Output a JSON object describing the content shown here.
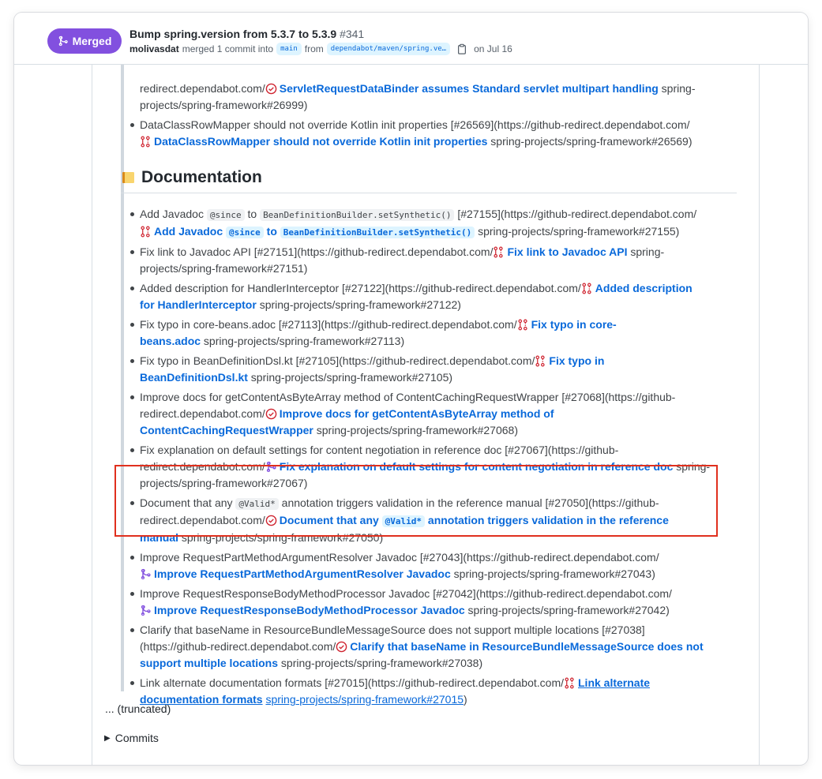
{
  "pr": {
    "status": "Merged",
    "title": "Bump spring.version from 5.3.7 to 5.3.9",
    "number": "#341",
    "author": "molivasdat",
    "merged_text": "merged 1 commit into",
    "base_branch": "main",
    "from_text": "from",
    "head_branch": "dependabot/maven/spring.ve…",
    "date": "on Jul 16",
    "badge_color": "#8250df"
  },
  "top_items": [
    {
      "pre": "redirect.dependabot.com/",
      "icon": "closed-check-icon",
      "link": "ServletRequestDataBinder assumes Standard servlet multipart handling",
      "post": " spring-",
      "line2": "projects/spring-framework#26999)"
    },
    {
      "pre": "DataClassRowMapper should not override Kotlin init properties [#26569](https://github-redirect.dependabot.com/",
      "icon": "issue-closed-icon",
      "link": "DataClassRowMapper should not override Kotlin init properties",
      "post": " spring-projects/spring-framework#26569)"
    }
  ],
  "heading": "Documentation",
  "doc_items": [
    {
      "a": "Add Javadoc ",
      "code1": "@since",
      "b": " to ",
      "code2": "BeanDefinitionBuilder.setSynthetic()",
      "c": " [#27155](https://github-redirect.dependabot.com/",
      "link_a": "Add Javadoc ",
      "link_code1": "@since",
      "link_b": " to ",
      "link_code2": "BeanDefinitionBuilder.setSynthetic()",
      "post": " spring-projects/spring-framework#27155)"
    },
    {
      "pre": "Fix link to Javadoc API [#27151](https://github-redirect.dependabot.com/",
      "link": "Fix link to Javadoc API",
      "post": " spring-",
      "line2": "projects/spring-framework#27151)"
    },
    {
      "pre": "Added description for HandlerInterceptor [#27122](https://github-redirect.dependabot.com/",
      "link": "Added description",
      "link2": "for HandlerInterceptor",
      "post": " spring-projects/spring-framework#27122)"
    },
    {
      "pre": "Fix typo in core-beans.adoc [#27113](https://github-redirect.dependabot.com/",
      "link": "Fix typo in core-",
      "link2": "beans.adoc",
      "post": " spring-projects/spring-framework#27113)"
    },
    {
      "pre": "Fix typo in BeanDefinitionDsl.kt [#27105](https://github-redirect.dependabot.com/",
      "link": "Fix typo in",
      "link2": "BeanDefinitionDsl.kt",
      "post": " spring-projects/spring-framework#27105)"
    },
    {
      "pre": "Improve docs for getContentAsByteArray method of ContentCachingRequestWrapper [#27068](https://github-",
      "pre2": "redirect.dependabot.com/",
      "link": "Improve docs for getContentAsByteArray method of",
      "link2": "ContentCachingRequestWrapper",
      "post": " spring-projects/spring-framework#27068)"
    },
    {
      "pre": "Fix explanation on default settings for content negotiation in reference doc [#27067](https://github-",
      "pre2": "redirect.dependabot.com/",
      "link": "Fix explanation on default settings for content negotiation in reference doc",
      "post": " spring-",
      "line3": "projects/spring-framework#27067)"
    },
    {
      "a": "Document that any ",
      "code1": "@Valid*",
      "b": " annotation triggers validation in the reference manual [#27050](https://github-",
      "pre2": "redirect.dependabot.com/",
      "link_a": "Document that any ",
      "link_code1": "@Valid*",
      "link_b": " annotation triggers validation in the reference",
      "link2": "manual",
      "post": " spring-projects/spring-framework#27050)"
    },
    {
      "pre": "Improve RequestPartMethodArgumentResolver Javadoc [#27043](https://github-redirect.dependabot.com/",
      "link": "Improve RequestPartMethodArgumentResolver Javadoc",
      "post": " spring-projects/spring-framework#27043)"
    },
    {
      "pre": "Improve RequestResponseBodyMethodProcessor Javadoc [#27042](https://github-redirect.dependabot.com/",
      "link": "Improve RequestResponseBodyMethodProcessor Javadoc",
      "post": " spring-projects/spring-framework#27042)"
    },
    {
      "pre": "Clarify that baseName in ResourceBundleMessageSource does not support multiple locations [#27038]",
      "pre2": "(https://github-redirect.dependabot.com/",
      "link": "Clarify that baseName in ResourceBundleMessageSource does not",
      "link2": "support multiple locations",
      "post": " spring-projects/spring-framework#27038)"
    },
    {
      "pre": "Link alternate documentation formats [#27015](https://github-redirect.dependabot.com/",
      "link": "Link alternate",
      "link2": "documentation formats",
      "post_link": "spring-projects/spring-framework#27015",
      "post": ")"
    }
  ],
  "truncated": "... (truncated)",
  "commits_label": "Commits"
}
